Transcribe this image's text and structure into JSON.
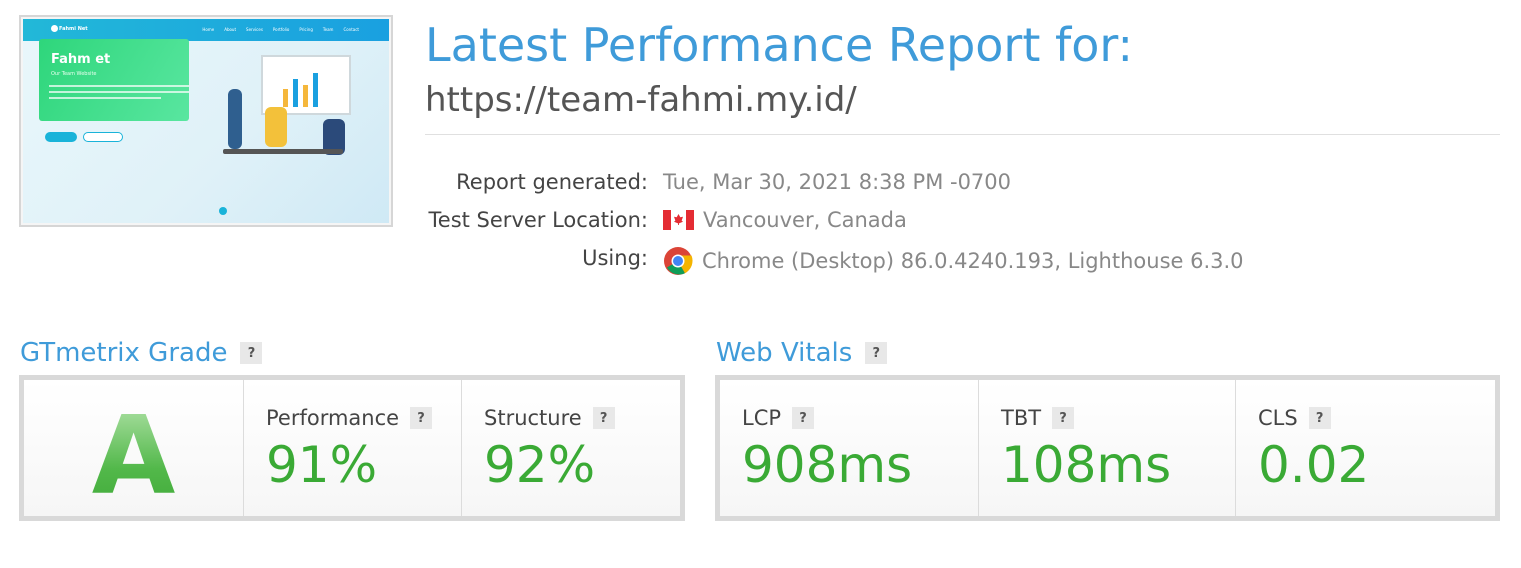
{
  "thumbnail": {
    "brand": "Fahmi Net",
    "menu": [
      "Home",
      "About",
      "Services",
      "Portfolio",
      "Pricing",
      "Team",
      "Contact"
    ],
    "hero_title": "Fahm  et",
    "hero_sub": "Our Team Website"
  },
  "header": {
    "title": "Latest Performance Report for:",
    "url": "https://team-fahmi.my.id/"
  },
  "meta": {
    "report_generated_label": "Report generated:",
    "report_generated_value": "Tue, Mar 30, 2021 8:38 PM -0700",
    "server_label": "Test Server Location:",
    "server_value": "Vancouver, Canada",
    "server_flag_icon": "canada-flag-icon",
    "using_label": "Using:",
    "using_value": "Chrome (Desktop) 86.0.4240.193, Lighthouse 6.3.0",
    "using_icon": "chrome-icon"
  },
  "grade_section": {
    "title": "GTmetrix Grade",
    "help": "?",
    "grade": "A",
    "performance_label": "Performance",
    "performance_value": "91%",
    "structure_label": "Structure",
    "structure_value": "92%"
  },
  "vitals_section": {
    "title": "Web Vitals",
    "help": "?",
    "lcp_label": "LCP",
    "lcp_value": "908ms",
    "tbt_label": "TBT",
    "tbt_value": "108ms",
    "cls_label": "CLS",
    "cls_value": "0.02"
  },
  "colors": {
    "accent_blue": "#3f9bd9",
    "grade_green": "#3aaa35"
  }
}
